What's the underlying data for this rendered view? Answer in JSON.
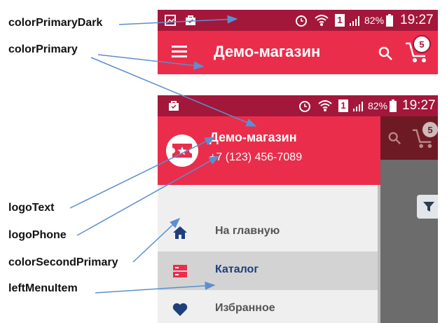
{
  "annotations": [
    {
      "id": "colorPrimaryDark",
      "text": "colorPrimaryDark"
    },
    {
      "id": "colorPrimary",
      "text": "colorPrimary"
    },
    {
      "id": "logoText",
      "text": "logoText"
    },
    {
      "id": "logoPhone",
      "text": "logoPhone"
    },
    {
      "id": "colorSecondPrimary",
      "text": "colorSecondPrimary"
    },
    {
      "id": "leftMenuItem",
      "text": "leftMenuItem"
    }
  ],
  "top_screen": {
    "status_bar": {
      "battery": "82%",
      "time": "19:27",
      "sim": "1"
    },
    "toolbar": {
      "title": "Демо-магазин",
      "cart_count": "5"
    }
  },
  "drawer_screen": {
    "status_bar": {
      "battery": "82%",
      "time": "19:27",
      "sim": "1"
    },
    "cart_count": "5",
    "header": {
      "logo_text": "Демо-магазин",
      "phone": "+7 (123) 456-7089"
    },
    "menu": [
      {
        "label": "На главную",
        "icon": "home-icon",
        "selected": false
      },
      {
        "label": "Каталог",
        "icon": "catalog-icon",
        "selected": true
      },
      {
        "label": "Избранное",
        "icon": "heart-icon",
        "selected": false
      }
    ]
  },
  "colors": {
    "colorPrimaryDark": "#a3173a",
    "colorPrimary": "#ea2d4b",
    "colorSecondPrimary": "#1f3f7a",
    "menuSelected": "#d3d3d3",
    "arrow": "#5b8fd0"
  }
}
